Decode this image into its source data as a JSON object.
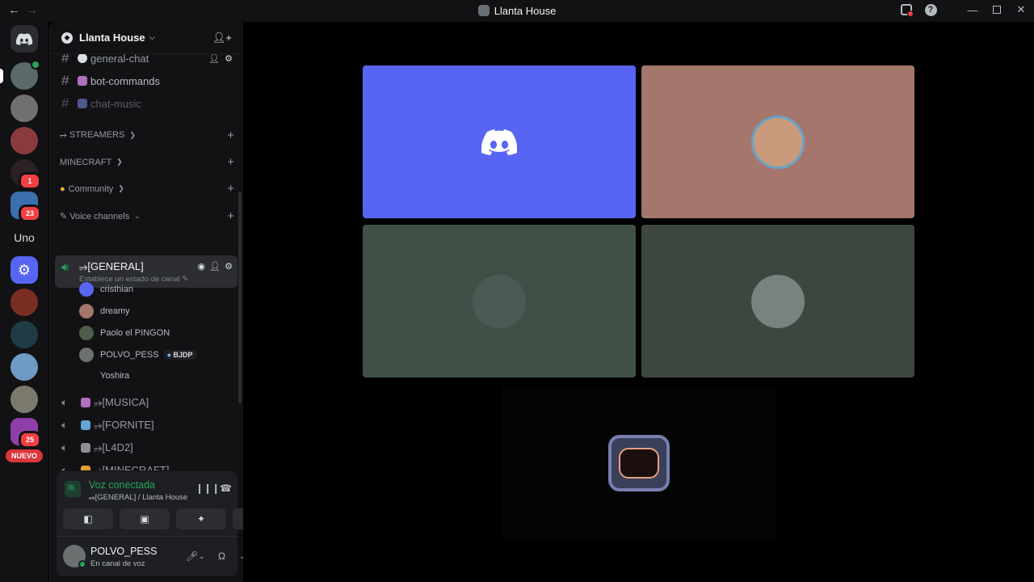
{
  "window": {
    "title": "Llanta House"
  },
  "rail": {
    "uno_label": "Uno",
    "badges": {
      "server_5": "1",
      "server_6": "23",
      "server_13": "25"
    },
    "nuevo_label": "NUEVO"
  },
  "server": {
    "name": "Llanta House"
  },
  "channels": {
    "text": [
      {
        "name": "general-chat"
      },
      {
        "name": "bot-commands"
      },
      {
        "name": "chat-music"
      }
    ],
    "categories": [
      {
        "name": "⭌ STREAMERS"
      },
      {
        "name": "MINECRAFT"
      },
      {
        "name": "Community"
      },
      {
        "name": "Voice channels"
      }
    ],
    "active_voice": {
      "name": "⭌[GENERAL]",
      "status": "Establece un estado de canal"
    },
    "voice_users": [
      {
        "name": "cristhian"
      },
      {
        "name": "dreamy"
      },
      {
        "name": "Paolo el PINGON"
      },
      {
        "name": "POLVO_PESS",
        "tag": "BJDP"
      },
      {
        "name": "Yoshira"
      }
    ],
    "voice": [
      {
        "name": "⭌[MUSICA]"
      },
      {
        "name": "⭌[FORNITE]"
      },
      {
        "name": "⭌[L4D2]"
      },
      {
        "name": "⭌[MINECRAFT]"
      }
    ]
  },
  "voice_panel": {
    "title": "Voz conectada",
    "subtitle": "⭌[GENERAL] / Llanta House"
  },
  "user_panel": {
    "name": "POLVO_PESS",
    "status": "En canal de voz"
  },
  "colors": {
    "blurple": "#5865f2",
    "tile_rose": "#a5766b",
    "tile_green": "#3f5147",
    "tile_gray": "#3d463f",
    "online": "#23a55a",
    "danger": "#da373c"
  }
}
